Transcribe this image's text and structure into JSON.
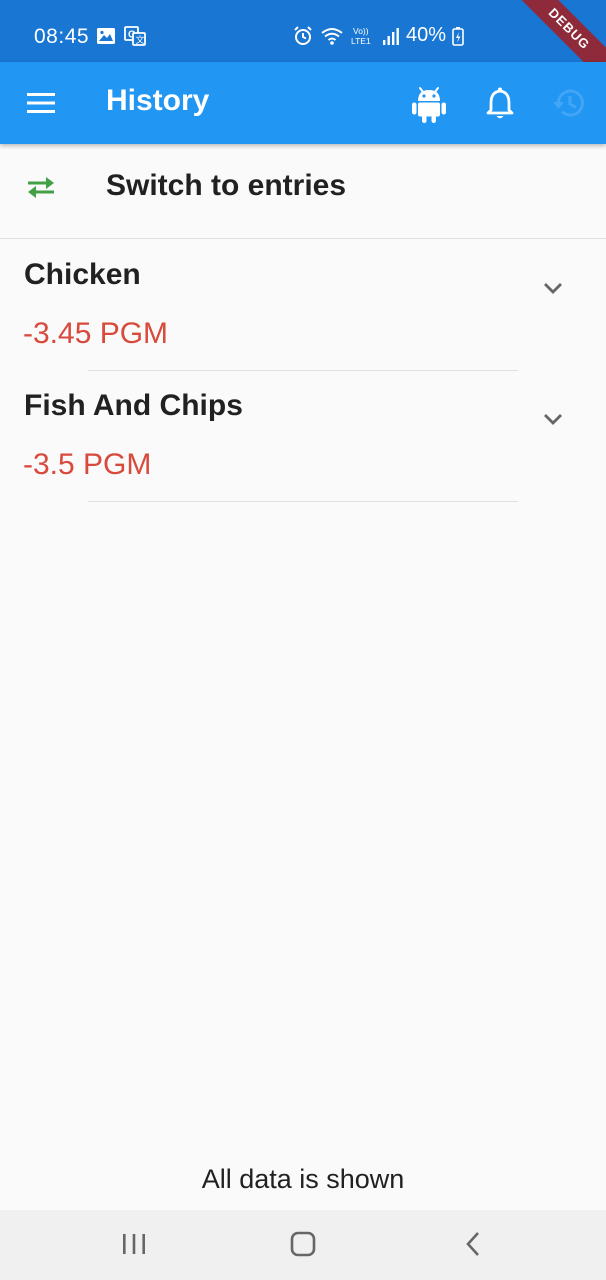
{
  "status_bar": {
    "time": "08:45",
    "battery": "40%",
    "left_icons": [
      "gallery-icon",
      "translate-icon"
    ],
    "right_icons": [
      "alarm-icon",
      "wifi-icon",
      "volte-icon",
      "signal-icon",
      "battery-icon"
    ],
    "background": "#1976d2"
  },
  "debug_banner": "DEBUG",
  "app_bar": {
    "title": "History",
    "background": "#2196f3",
    "actions": [
      "android-icon",
      "bell-icon",
      "history-icon"
    ],
    "active_action_color": "#42a5f5"
  },
  "switch_row": {
    "label": "Switch to entries",
    "icon": "swap-arrows-icon",
    "icon_color": "#43a047"
  },
  "entries": [
    {
      "title": "Chicken",
      "amount": "-3.45 PGM"
    },
    {
      "title": "Fish And Chips",
      "amount": "-3.5 PGM"
    }
  ],
  "amount_color": "#d84a3c",
  "footer": "All data is shown",
  "nav_bar": [
    "recent-apps-icon",
    "home-icon",
    "back-icon"
  ]
}
